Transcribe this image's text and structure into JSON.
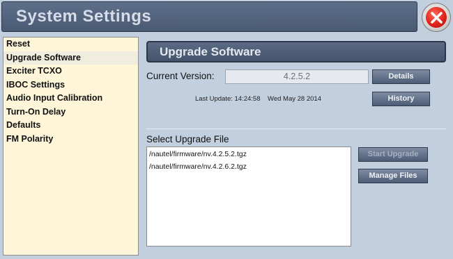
{
  "window": {
    "title": "System Settings"
  },
  "sidebar": {
    "items": [
      {
        "label": "Reset"
      },
      {
        "label": "Upgrade Software"
      },
      {
        "label": "Exciter TCXO"
      },
      {
        "label": "IBOC Settings"
      },
      {
        "label": "Audio Input Calibration"
      },
      {
        "label": "Turn-On Delay"
      },
      {
        "label": "Defaults"
      },
      {
        "label": "FM Polarity"
      }
    ]
  },
  "panel": {
    "title": "Upgrade Software",
    "current_version_label": "Current Version:",
    "current_version_value": "4.2.5.2",
    "last_update_text": "Last Update: 14:24:58    Wed May 28 2014",
    "details_label": "Details",
    "history_label": "History",
    "select_file_label": "Select Upgrade File",
    "files": [
      "/nautel/firmware/nv.4.2.5.2.tgz",
      "/nautel/firmware/nv.4.2.6.2.tgz"
    ],
    "start_upgrade_label": "Start Upgrade",
    "manage_files_label": "Manage Files"
  }
}
